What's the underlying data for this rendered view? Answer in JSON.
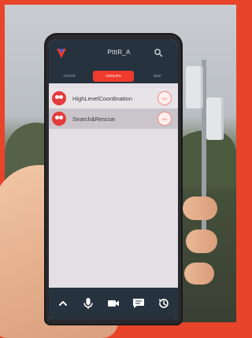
{
  "app": {
    "title": "PtttR_A"
  },
  "tabs": [
    {
      "label": "CHATS",
      "active": false
    },
    {
      "label": "GROUPS",
      "active": true
    },
    {
      "label": "MAP",
      "active": false
    }
  ],
  "groups": [
    {
      "name": "HighLevelCoordination",
      "badge": "GO",
      "selected": false
    },
    {
      "name": "Search&Rescue",
      "badge": "GO",
      "selected": true
    }
  ],
  "bottom_bar": {
    "icons": [
      "chevron-up-icon",
      "microphone-icon",
      "video-camera-icon",
      "chat-icon",
      "history-icon"
    ]
  },
  "colors": {
    "accent": "#ef3b2d",
    "header": "#26323d",
    "frame": "#e8442a"
  }
}
